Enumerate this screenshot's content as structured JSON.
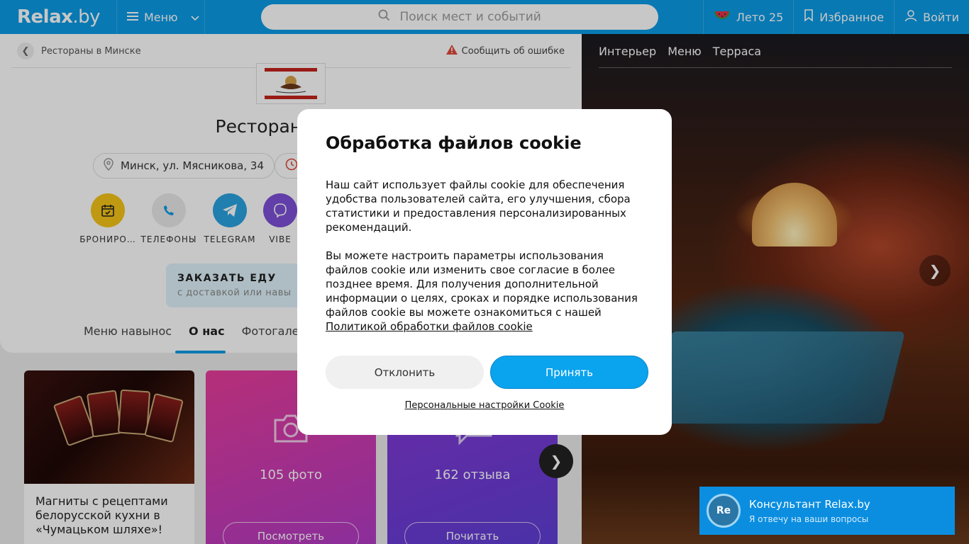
{
  "header": {
    "logo_main": "Relax",
    "logo_suffix": ".by",
    "menu_label": "Меню",
    "search_placeholder": "Поиск мест и событий",
    "summer_label": "Лето 25",
    "favorites_label": "Избранное",
    "login_label": "Войти"
  },
  "page": {
    "breadcrumb": "Рестораны в Минске",
    "report_label": "Сообщить об ошибке",
    "title": "Ресторан «Чума",
    "address": "Минск, ул. Мясникова, 34",
    "actions": [
      {
        "label": "БРОНИРО…"
      },
      {
        "label": "ТЕЛЕФОНЫ"
      },
      {
        "label": "TELEGRAM"
      },
      {
        "label": "VIBE"
      }
    ],
    "order": {
      "title": "ЗАКАЗАТЬ ЕДУ",
      "subtitle": "с доставкой или навы"
    },
    "tabs": [
      "Меню навынос",
      "О нас",
      "Фотогалере"
    ]
  },
  "cards": {
    "news_text": "Магниты с рецептами белорусской кухни в «Чумацьком шляхе»!",
    "photos_count": "105 фото",
    "photos_button": "Посмотреть",
    "reviews_count": "162 отзыва",
    "reviews_button": "Почитать"
  },
  "gallery": {
    "tabs": [
      "Интерьер",
      "Меню",
      "Терраса"
    ]
  },
  "cookie": {
    "title": "Обработка файлов cookie",
    "paragraph1": "Наш сайт использует файлы cookie для обеспечения удобства пользователей сайта, его улучшения, сбора статистики и предоставления персонализированных рекомендаций.",
    "paragraph2": "Вы можете настроить параметры использования файлов cookie или изменить свое согласие в более позднее время. Для получения дополнительной информации о целях, сроках и порядке использования файлов cookie вы можете ознакомиться с нашей",
    "policy_link": "Политикой обработки файлов cookie",
    "decline_label": "Отклонить",
    "accept_label": "Принять",
    "personal_settings": "Персональные настройки Cookie"
  },
  "consultant": {
    "avatar_text": "Re",
    "name": "Консультант Relax.by",
    "subtitle": "Я отвечу на ваши вопросы"
  },
  "colors": {
    "brand_blue": "#0b9be6",
    "accept_blue": "#0aa3ee",
    "booking_yellow": "#f5c518",
    "telegram_blue": "#2aa3e0",
    "viber_purple": "#7d50d8"
  }
}
